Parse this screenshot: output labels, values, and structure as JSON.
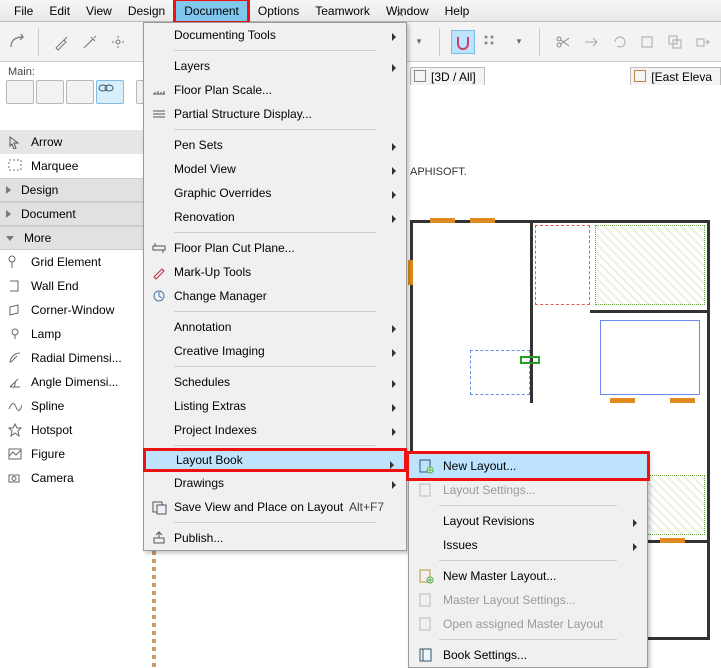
{
  "menubar": {
    "items": [
      "File",
      "Edit",
      "View",
      "Design",
      "Document",
      "Options",
      "Teamwork",
      "Window",
      "Help"
    ]
  },
  "panel_title": "Main:",
  "tabs": {
    "tab3d": "[3D / All]",
    "tabE": "[East Eleva"
  },
  "watermark": "APHISOFT.",
  "sidebar": {
    "arrow": "Arrow",
    "marquee": "Marquee",
    "designCat": "Design",
    "docCat": "Document",
    "moreCat": "More",
    "gridElement": "Grid Element",
    "wallEnd": "Wall End",
    "cornerWindow": "Corner-Window",
    "lamp": "Lamp",
    "radial": "Radial Dimensi...",
    "angle": "Angle Dimensi...",
    "spline": "Spline",
    "hotspot": "Hotspot",
    "figure": "Figure",
    "camera": "Camera"
  },
  "menu": {
    "documentingTools": "Documenting Tools",
    "layers": "Layers",
    "floorPlanScale": "Floor Plan Scale...",
    "partialStructure": "Partial Structure Display...",
    "penSets": "Pen Sets",
    "modelView": "Model View",
    "graphicOverrides": "Graphic Overrides",
    "renovation": "Renovation",
    "floorPlanCut": "Floor Plan Cut Plane...",
    "markup": "Mark-Up Tools",
    "changeManager": "Change Manager",
    "annotation": "Annotation",
    "creativeImaging": "Creative Imaging",
    "schedules": "Schedules",
    "listingExtras": "Listing Extras",
    "projectIndexes": "Project Indexes",
    "layoutBook": "Layout Book",
    "drawings": "Drawings",
    "saveView": "Save View and Place on Layout",
    "saveViewAccel": "Alt+F7",
    "publish": "Publish..."
  },
  "submenu": {
    "newLayout": "New Layout...",
    "layoutSettings": "Layout Settings...",
    "layoutRevisions": "Layout Revisions",
    "issues": "Issues",
    "newMaster": "New Master Layout...",
    "masterSettings": "Master Layout Settings...",
    "openMaster": "Open assigned Master Layout",
    "bookSettings": "Book Settings..."
  }
}
